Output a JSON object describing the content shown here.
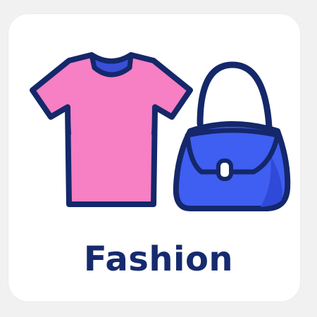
{
  "tile": {
    "label": "Fashion"
  },
  "icons": {
    "shirt": "t-shirt-icon",
    "bag": "handbag-icon"
  },
  "colors": {
    "outline": "#14286a",
    "shirt": "#f77fc4",
    "collar": "#3a4fd8",
    "bag": "#3f5ef2",
    "bag_shade": "#2f49d8",
    "label": "#162a6e",
    "card": "#ffffff",
    "background": "#f1f1f1"
  }
}
